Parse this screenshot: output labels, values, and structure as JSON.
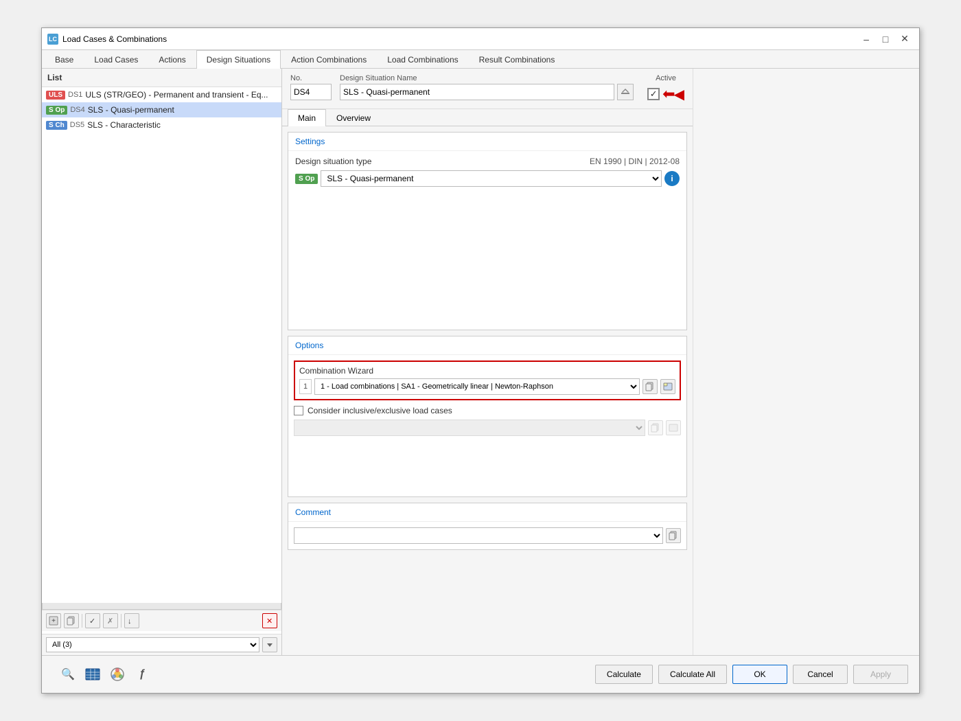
{
  "window": {
    "title": "Load Cases & Combinations",
    "icon": "LC"
  },
  "tabs": [
    {
      "id": "base",
      "label": "Base",
      "active": false
    },
    {
      "id": "load-cases",
      "label": "Load Cases",
      "active": false
    },
    {
      "id": "actions",
      "label": "Actions",
      "active": false
    },
    {
      "id": "design-situations",
      "label": "Design Situations",
      "active": true
    },
    {
      "id": "action-combinations",
      "label": "Action Combinations",
      "active": false
    },
    {
      "id": "load-combinations",
      "label": "Load Combinations",
      "active": false
    },
    {
      "id": "result-combinations",
      "label": "Result Combinations",
      "active": false
    }
  ],
  "list": {
    "header": "List",
    "items": [
      {
        "badge": "ULS",
        "badgeClass": "badge-uls",
        "id": "DS1",
        "text": "ULS (STR/GEO) - Permanent and transient - Eq...",
        "selected": false
      },
      {
        "badge": "S Op",
        "badgeClass": "badge-sop",
        "id": "DS4",
        "text": "SLS - Quasi-permanent",
        "selected": true
      },
      {
        "badge": "S Ch",
        "badgeClass": "badge-sch",
        "id": "DS5",
        "text": "SLS - Characteristic",
        "selected": false
      }
    ],
    "filter": {
      "label": "All (3)",
      "options": [
        "All (3)"
      ]
    }
  },
  "detail": {
    "no_label": "No.",
    "no_value": "DS4",
    "name_label": "Design Situation Name",
    "name_value": "SLS - Quasi-permanent",
    "active_label": "Active",
    "active_checked": true
  },
  "inner_tabs": [
    {
      "label": "Main",
      "active": true
    },
    {
      "label": "Overview",
      "active": false
    }
  ],
  "settings": {
    "section_title": "Settings",
    "type_label": "Design situation type",
    "type_standard": "EN 1990 | DIN | 2012-08",
    "type_badge": "S Op",
    "type_value": "SLS - Quasi-permanent"
  },
  "options": {
    "section_title": "Options",
    "combination_wizard": {
      "label": "Combination Wizard",
      "num": "1",
      "value": "1 - Load combinations | SA1 - Geometrically linear | Newton-Raphson"
    },
    "inclusive": {
      "label": "Consider inclusive/exclusive load cases",
      "checked": false
    }
  },
  "comment": {
    "section_title": "Comment"
  },
  "buttons": {
    "calculate": "Calculate",
    "calculate_all": "Calculate All",
    "ok": "OK",
    "cancel": "Cancel",
    "apply": "Apply"
  },
  "toolbar": {
    "add": "+",
    "copy": "⧉",
    "check": "✓",
    "uncheck": "✗",
    "import": "↓",
    "delete": "✕"
  },
  "bottom_icons": {
    "search": "🔍",
    "table": "▦",
    "color": "🎨",
    "formula": "ƒ"
  }
}
